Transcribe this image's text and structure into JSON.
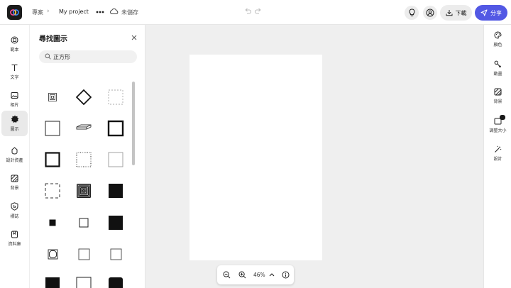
{
  "header": {
    "home_label": "專案",
    "separator": "›",
    "project_name": "My project",
    "save_status": "未儲存",
    "download_label": "下載",
    "share_label": "分享"
  },
  "left_rail": {
    "items": [
      {
        "label": "範本",
        "icon": "template-icon"
      },
      {
        "label": "文字",
        "icon": "text-icon"
      },
      {
        "label": "相片",
        "icon": "photo-icon"
      },
      {
        "label": "圖示",
        "icon": "icons-icon",
        "active": true
      },
      {
        "label": "設計資產",
        "icon": "design-assets-icon"
      },
      {
        "label": "背景",
        "icon": "background-icon"
      },
      {
        "label": "標誌",
        "icon": "logo-icon"
      },
      {
        "label": "資料庫",
        "icon": "library-icon"
      }
    ]
  },
  "panel": {
    "title": "尋找圖示",
    "search_value": "正方形",
    "search_placeholder": "正方形",
    "shapes": [
      "concentric-small-square",
      "diamond-outline",
      "dashed-square",
      "square-outline",
      "3d-flat-box",
      "thick-square-outline",
      "bold-square-outline",
      "dotted-square",
      "light-square",
      "dashed-bracket-square",
      "spiral-square",
      "filled-square",
      "small-filled-square",
      "small-square-outline",
      "filled-square-2",
      "octagon-square",
      "square-outline-2",
      "square-outline-3",
      "filled-square-3",
      "square-outline-4",
      "rounded-filled-square"
    ]
  },
  "zoom": {
    "level": "46%"
  },
  "right_rail": {
    "items": [
      {
        "label": "顏色",
        "icon": "palette-icon"
      },
      {
        "label": "動畫",
        "icon": "animation-icon"
      },
      {
        "label": "背景",
        "icon": "background-icon"
      },
      {
        "label": "調整大小",
        "icon": "resize-icon"
      },
      {
        "label": "設計",
        "icon": "magic-wand-icon"
      }
    ]
  },
  "colors": {
    "accent": "#5258e4",
    "canvas_bg": "#efefef",
    "page": "#ffffff"
  }
}
